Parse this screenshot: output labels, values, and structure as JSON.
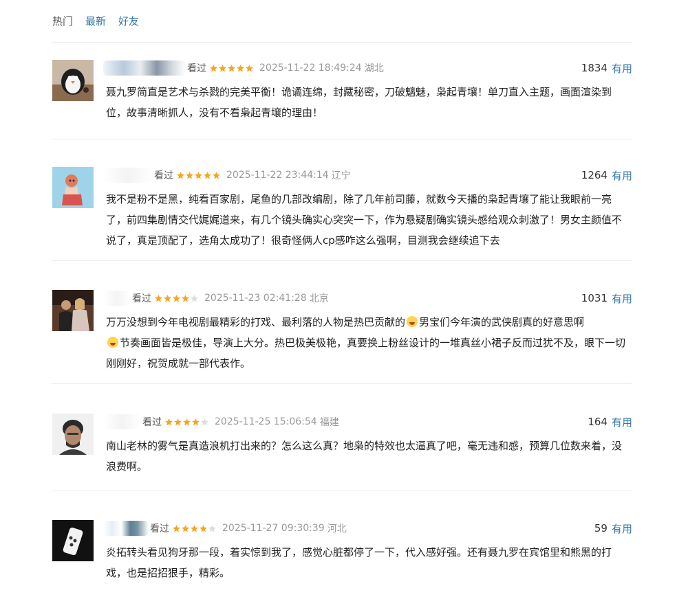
{
  "tabs": [
    {
      "label": "热门",
      "active": true
    },
    {
      "label": "最新",
      "active": false
    },
    {
      "label": "好友",
      "active": false
    }
  ],
  "comments": [
    {
      "watched": "看过",
      "rating": 5,
      "time": "2025-11-22 18:49:24",
      "location": "湖北",
      "votes": "1834",
      "useful": "有用",
      "text": "聂九罗简直是艺术与杀戮的完美平衡！诡谲连绵，封藏秘密，刀破魑魅，枭起青壤！单刀直入主题，画面渲染到位，故事清晰抓人，没有不看枭起青壤的理由！",
      "avatar": "penguin-plush-icon"
    },
    {
      "watched": "看过",
      "rating": 5,
      "time": "2025-11-22 23:44:14",
      "location": "辽宁",
      "votes": "1264",
      "useful": "有用",
      "text": "我不是粉不是黑，纯看百家剧，尾鱼的几部改编剧，除了几年前司藤，就数今天播的枭起青壤了能让我眼前一亮了，前四集剧情交代娓娓道来，有几个镜头确实心突突一下，作为悬疑剧确实镜头感给观众刺激了！男女主颜值不说了，真是顶配了，选角太成功了！很奇怪俩人cp感咋这么强啊，目测我会继续追下去",
      "avatar": "figurine-icon"
    },
    {
      "watched": "看过",
      "rating": 4,
      "time": "2025-11-23 02:41:28",
      "location": "北京",
      "votes": "1031",
      "useful": "有用",
      "text_parts": [
        "万万没想到今年电视剧最精彩的打戏、最利落的人物是热巴贡献的",
        "男宝们今年演的武侠剧真的好意思啊",
        "节奏画面皆是极佳，导演上大分。热巴极美极艳，真要换上粉丝设计的一堆真丝小裙子反而过犹不及，眼下一切刚刚好，祝贺成就一部代表作。"
      ],
      "avatar": "couple-photo-icon"
    },
    {
      "watched": "看过",
      "rating": 4,
      "time": "2025-11-25 15:06:54",
      "location": "福建",
      "votes": "164",
      "useful": "有用",
      "text": "南山老林的雾气是真造浪机打出来的？怎么这么真？地枭的特效也太逼真了吧，毫无违和感，预算几位数来着，没浪费啊。",
      "avatar": "man-portrait-icon"
    },
    {
      "watched": "看过",
      "rating": 4,
      "time": "2025-11-27 09:30:39",
      "location": "河北",
      "votes": "59",
      "useful": "有用",
      "text": "炎拓转头看见狗牙那一段，着实惊到我了，感觉心脏都停了一下，代入感好强。还有聂九罗在宾馆里和熊黑的打戏，也是招招狠手，精彩。",
      "avatar": "cup-icon"
    }
  ],
  "colors": {
    "link": "#3377aa",
    "star": "#f5a623",
    "star_empty": "#dddddd"
  }
}
